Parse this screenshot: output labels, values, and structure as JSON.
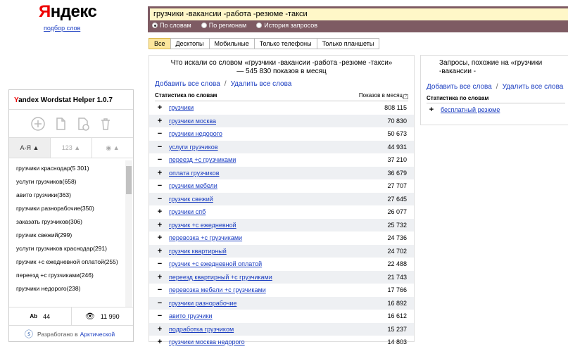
{
  "logo": {
    "first": "Я",
    "rest": "ндекс"
  },
  "sublink": "подбор слов",
  "search": {
    "value": "грузчики -вакансии -работа -резюме -такси",
    "radios": [
      {
        "label": "По словам",
        "on": true
      },
      {
        "label": "По регионам",
        "on": false
      },
      {
        "label": "История запросов",
        "on": false
      }
    ]
  },
  "tabs": [
    "Все",
    "Десктопы",
    "Мобильные",
    "Только телефоны",
    "Только планшеты"
  ],
  "main": {
    "title": "Что искали со словом «грузчики -вакансии -работа -резюме -такси» — 545 830 показов в месяц",
    "add_all": "Добавить все слова",
    "remove_all": "Удалить все слова",
    "sep": "/",
    "col_words": "Статистика по словам",
    "col_count": "Показов в месяц",
    "rows": [
      {
        "sign": "+",
        "text": "грузчики",
        "count": "808 115"
      },
      {
        "sign": "+",
        "text": "грузчики москва",
        "count": "70 830"
      },
      {
        "sign": "−",
        "text": "грузчики недорого",
        "count": "50 673"
      },
      {
        "sign": "−",
        "text": "услуги грузчиков",
        "count": "44 931"
      },
      {
        "sign": "−",
        "text": "переезд +с грузчиками",
        "count": "37 210"
      },
      {
        "sign": "+",
        "text": "оплата грузчиков",
        "count": "36 679"
      },
      {
        "sign": "−",
        "text": "грузчики мебели",
        "count": "27 707"
      },
      {
        "sign": "−",
        "text": "грузчик свежий",
        "count": "27 645"
      },
      {
        "sign": "+",
        "text": "грузчики спб",
        "count": "26 077"
      },
      {
        "sign": "+",
        "text": "грузчик +с ежедневной",
        "count": "25 732"
      },
      {
        "sign": "+",
        "text": "перевозка +с грузчиками",
        "count": "24 736"
      },
      {
        "sign": "+",
        "text": "грузчик квартирный",
        "count": "24 702"
      },
      {
        "sign": "−",
        "text": "грузчик +с ежедневной оплатой",
        "count": "22 488"
      },
      {
        "sign": "+",
        "text": "переезд квартирный +с грузчиками",
        "count": "21 743"
      },
      {
        "sign": "−",
        "text": "перевозка мебели +с грузчиками",
        "count": "17 766"
      },
      {
        "sign": "−",
        "text": "грузчики разнорабочие",
        "count": "16 892"
      },
      {
        "sign": "−",
        "text": "авито грузчики",
        "count": "16 612"
      },
      {
        "sign": "+",
        "text": "подработка грузчиком",
        "count": "15 237"
      },
      {
        "sign": "+",
        "text": "грузчики москва недорого",
        "count": "14 803"
      }
    ]
  },
  "similar": {
    "title": "Запросы, похожие на «грузчики -вакансии -",
    "add_all": "Добавить все слова",
    "remove_all": "Удалить все слова",
    "sep": "/",
    "col_words": "Статистика по словам",
    "rows": [
      {
        "sign": "+",
        "text": "бесплатный резюме"
      }
    ]
  },
  "helper": {
    "title_first": "Y",
    "title_rest": "andex Wordstat Helper 1.0.7",
    "sort": [
      "А-Я ▲",
      "123 ▲",
      "◉ ▲"
    ],
    "items": [
      "грузчики краснодар(5 301)",
      "услуги грузчиков(658)",
      "авито грузчики(363)",
      "грузчики разнорабочие(350)",
      "заказать грузчиков(306)",
      "грузчик свежий(299)",
      "услуги грузчиков краснодар(291)",
      "грузчик +с ежедневной оплатой(255)",
      "переезд +с грузчиками(246)",
      "грузчики недорого(238)"
    ],
    "words": "44",
    "shows": "11 990",
    "words_icon": "Ab",
    "footer": "Разработано в",
    "footer_link": "Арктической"
  }
}
